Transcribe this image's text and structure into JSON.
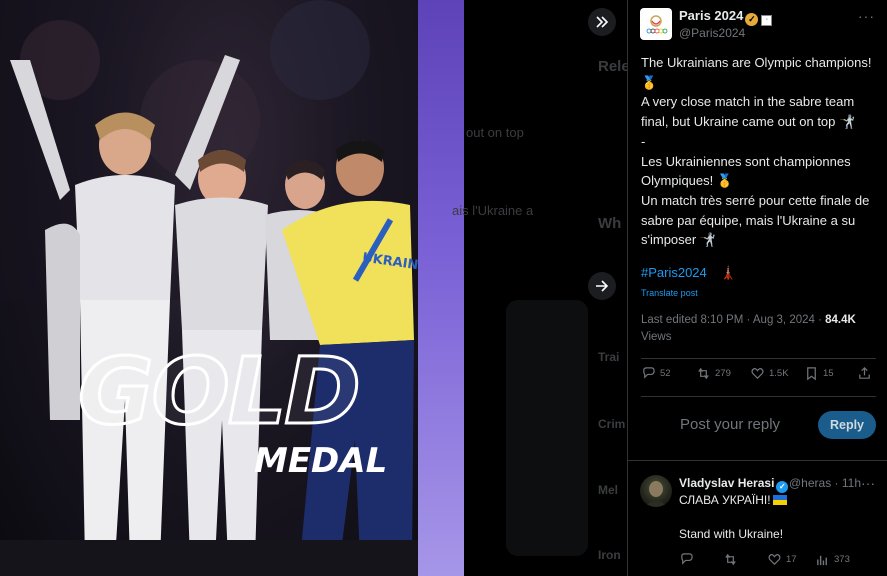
{
  "media": {
    "headline_big": "GOLD",
    "headline_small": "MEDAL",
    "jersey_text": "UKRAINE",
    "nav_forward_icon": "double-chevron-right-icon",
    "nav_next_icon": "arrow-right-icon"
  },
  "background_page": {
    "fragments": [
      "Rele",
      "out on top",
      "ais l'Ukraine a",
      "Wh",
      "Trai",
      "Crim",
      "Mel",
      "Iron"
    ]
  },
  "post": {
    "author_name": "Paris 2024",
    "author_handle": "@Paris2024",
    "body_lines": [
      "The Ukrainians are Olympic champions!🥇",
      "A very close match in the sabre team final, but Ukraine came out on top 🤺",
      "-",
      "Les Ukrainiennes sont championnes Olympiques! 🥇",
      "Un match très serré pour cette finale de sabre par équipe, mais l'Ukraine a su s'imposer 🤺"
    ],
    "hashtag": "#Paris2024",
    "hashtag_emoji": "🗼",
    "translate_label": "Translate post",
    "edited_label": "Last edited 8:10 PM · Aug 3, 2024 · ",
    "views_count": "84.4K",
    "views_label": "Views",
    "stats": {
      "replies": "52",
      "reposts": "279",
      "likes": "1.5K",
      "bookmarks": "15"
    }
  },
  "composer": {
    "placeholder": "Post your reply",
    "reply_button": "Reply"
  },
  "reply": {
    "author_name": "Vladyslav Herasi",
    "author_handle": "@heras · 11h",
    "text_line1": "СЛАВА УКРАЇНІ!",
    "text_line2": "Stand with Ukraine!",
    "likes": "17",
    "views": "373"
  },
  "colors": {
    "accent": "#1d9bf0",
    "gold_badge": "#e5a93c",
    "strip_purple": "#6b50c8",
    "reply_button": "#1a5c8c"
  }
}
